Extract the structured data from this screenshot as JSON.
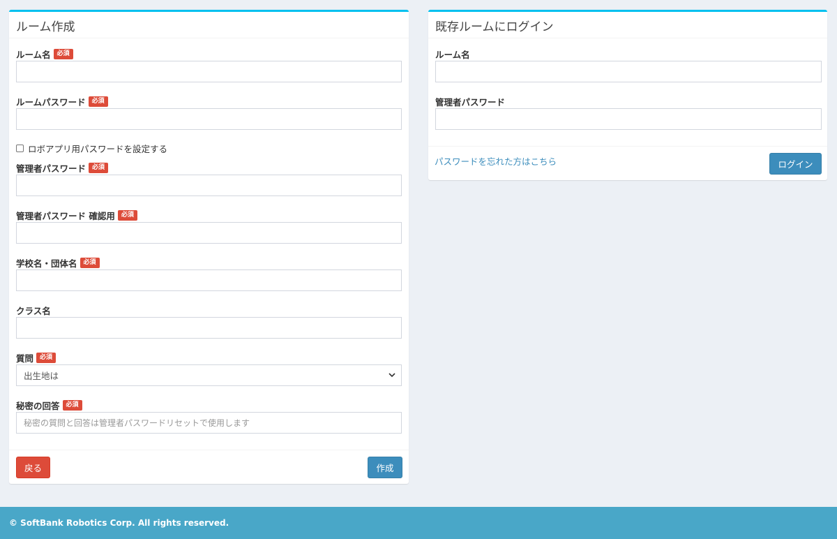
{
  "create_room": {
    "title": "ルーム作成",
    "required_badge": "必須",
    "room_name_label": "ルーム名",
    "room_password_label": "ルームパスワード",
    "robo_app_checkbox_label": "ロボアプリ用パスワードを設定する",
    "admin_password_label": "管理者パスワード",
    "admin_password_confirm_label": "管理者パスワード 確認用",
    "school_name_label": "学校名・団体名",
    "class_name_label": "クラス名",
    "question_label": "質問",
    "question_selected": "出生地は",
    "secret_answer_label": "秘密の回答",
    "secret_answer_placeholder": "秘密の質問と回答は管理者パスワードリセットで使用します",
    "back_button": "戻る",
    "create_button": "作成"
  },
  "login_room": {
    "title": "既存ルームにログイン",
    "room_name_label": "ルーム名",
    "admin_password_label": "管理者パスワード",
    "forgot_password_link": "パスワードを忘れた方はこちら",
    "login_button": "ログイン"
  },
  "footer": {
    "copyright": "© SoftBank Robotics Corp. All rights reserved."
  },
  "colors": {
    "box_top_border": "#00c0ef",
    "danger": "#dd4b39",
    "primary": "#3c8dbc",
    "footer_bg": "#49a7c8",
    "page_bg": "#ecf0f5"
  }
}
